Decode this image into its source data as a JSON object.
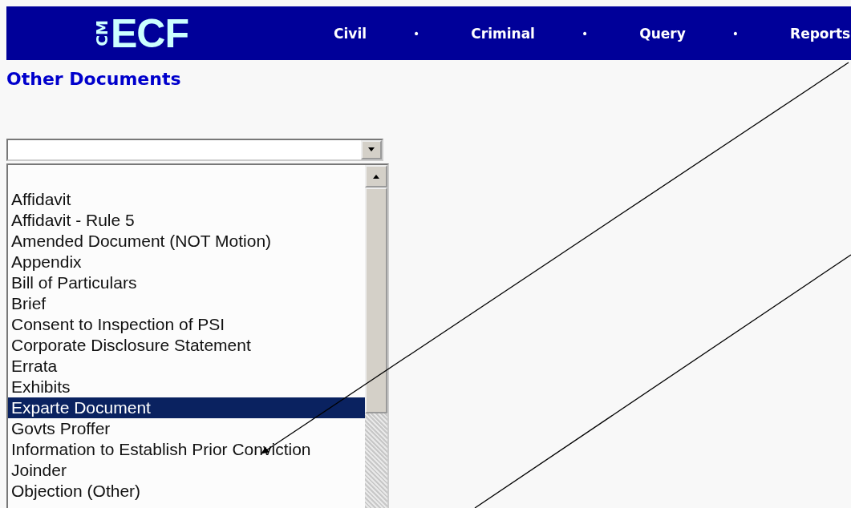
{
  "header": {
    "logo_small": "CM",
    "logo": "ECF",
    "nav": [
      {
        "label": "Civil",
        "separator": "•"
      },
      {
        "label": "Criminal",
        "separator": "•"
      },
      {
        "label": "Query",
        "separator": "•"
      },
      {
        "label": "Reports"
      }
    ]
  },
  "page_title": "Other Documents",
  "listbox": {
    "items": [
      {
        "label": "Affidavit",
        "selected": false
      },
      {
        "label": "Affidavit - Rule 5",
        "selected": false
      },
      {
        "label": "Amended Document (NOT Motion)",
        "selected": false
      },
      {
        "label": "Appendix",
        "selected": false
      },
      {
        "label": "Bill of Particulars",
        "selected": false
      },
      {
        "label": "Brief",
        "selected": false
      },
      {
        "label": "Consent to Inspection of PSI",
        "selected": false
      },
      {
        "label": "Corporate Disclosure Statement",
        "selected": false
      },
      {
        "label": "Errata",
        "selected": false
      },
      {
        "label": "Exhibits",
        "selected": false
      },
      {
        "label": "Exparte Document",
        "selected": true
      },
      {
        "label": "Govts Proffer",
        "selected": false
      },
      {
        "label": "Information to Establish Prior Conviction",
        "selected": false
      },
      {
        "label": "Joinder",
        "selected": false
      },
      {
        "label": "Objection (Other)",
        "selected": false
      }
    ]
  }
}
